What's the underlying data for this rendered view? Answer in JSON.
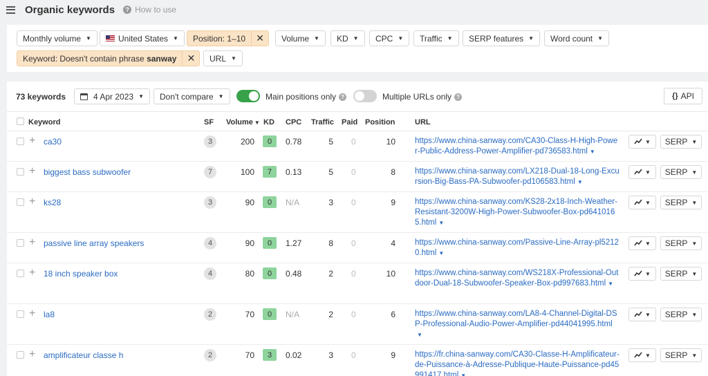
{
  "header": {
    "title": "Organic keywords",
    "help_label": "How to use"
  },
  "filters": {
    "monthly_volume": "Monthly volume",
    "country": "United States",
    "position": "Position: 1–10",
    "volume": "Volume",
    "kd": "KD",
    "cpc": "CPC",
    "traffic": "Traffic",
    "serp_features": "SERP features",
    "word_count": "Word count",
    "keyword_filter_prefix": "Keyword: Doesn't contain phrase",
    "keyword_filter_phrase": "sanway",
    "url": "URL"
  },
  "toolbar": {
    "keyword_count": "73 keywords",
    "date": "4 Apr 2023",
    "compare": "Don't compare",
    "main_positions_label": "Main positions only",
    "main_positions_on": true,
    "multiple_urls_label": "Multiple URLs only",
    "multiple_urls_on": false,
    "api_label": "API"
  },
  "columns": {
    "keyword": "Keyword",
    "sf": "SF",
    "volume": "Volume",
    "kd": "KD",
    "cpc": "CPC",
    "traffic": "Traffic",
    "paid": "Paid",
    "position": "Position",
    "url": "URL"
  },
  "rows": [
    {
      "keyword": "ca30",
      "sf": "3",
      "volume": "200",
      "kd": "0",
      "cpc": "0.78",
      "traffic": "5",
      "paid": "0",
      "position": "10",
      "url": "https://www.china-sanway.com/CA30-Class-H-High-Power-Public-Address-Power-Amplifier-pd736583.html",
      "serp": "SERP"
    },
    {
      "keyword": "biggest bass subwoofer",
      "sf": "7",
      "volume": "100",
      "kd": "7",
      "cpc": "0.13",
      "traffic": "5",
      "paid": "0",
      "position": "8",
      "url": "https://www.china-sanway.com/LX218-Dual-18-Long-Excursion-Big-Bass-PA-Subwoofer-pd106583.html",
      "serp": "SERP"
    },
    {
      "keyword": "ks28",
      "sf": "3",
      "volume": "90",
      "kd": "0",
      "cpc": "N/A",
      "traffic": "3",
      "paid": "0",
      "position": "9",
      "url": "https://www.china-sanway.com/KS28-2x18-Inch-Weather-Resistant-3200W-High-Power-Subwoofer-Box-pd6410165.html",
      "serp": "SERP"
    },
    {
      "keyword": "passive line array speakers",
      "sf": "4",
      "volume": "90",
      "kd": "0",
      "cpc": "1.27",
      "traffic": "8",
      "paid": "0",
      "position": "4",
      "url": "https://www.china-sanway.com/Passive-Line-Array-pl52120.html",
      "serp": "SERP"
    },
    {
      "keyword": "18 inch speaker box",
      "sf": "4",
      "volume": "80",
      "kd": "0",
      "cpc": "0.48",
      "traffic": "2",
      "paid": "0",
      "position": "10",
      "url": "https://www.china-sanway.com/WS218X-Professional-Outdoor-Dual-18-Subwoofer-Speaker-Box-pd997683.html",
      "serp": "SERP"
    },
    {
      "keyword": "la8",
      "sf": "2",
      "volume": "70",
      "kd": "0",
      "cpc": "N/A",
      "traffic": "2",
      "paid": "0",
      "position": "6",
      "url": "https://www.china-sanway.com/LA8-4-Channel-Digital-DSP-Professional-Audio-Power-Amplifier-pd44041995.html",
      "serp": "SERP"
    },
    {
      "keyword": "amplificateur classe h",
      "sf": "2",
      "volume": "70",
      "kd": "3",
      "cpc": "0.02",
      "traffic": "3",
      "paid": "0",
      "position": "9",
      "url": "https://fr.china-sanway.com/CA30-Classe-H-Amplificateur-de-Puissance-à-Adresse-Publique-Haute-Puissance-pd45991417.html",
      "serp": "SERP"
    }
  ],
  "icons": {
    "menu": "hamburger-icon",
    "help": "question-circle-icon",
    "calendar": "calendar-icon",
    "trend": "trend-chart-icon",
    "close": "close-icon"
  },
  "colors": {
    "accent_link": "#2a6bc2",
    "active_filter": "#fbe3c6",
    "toggle_on": "#38a24a",
    "kd_badge": "#8ed49c"
  }
}
